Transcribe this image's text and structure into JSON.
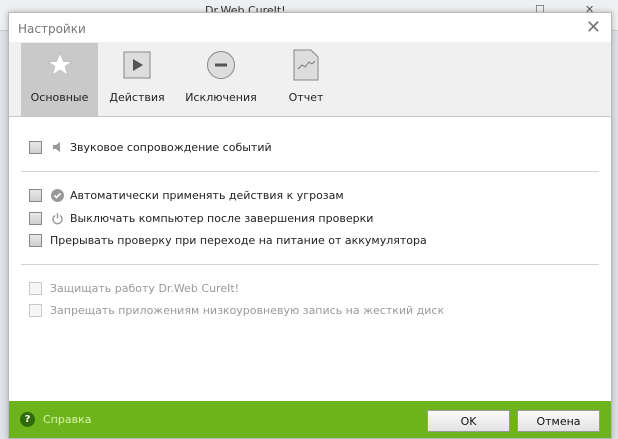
{
  "background_window": {
    "title": "Dr.Web CureIt!"
  },
  "dialog": {
    "title": "Настройки"
  },
  "tabs": [
    {
      "label": "Основные",
      "icon": "star-icon",
      "selected": true
    },
    {
      "label": "Действия",
      "icon": "play-icon",
      "selected": false
    },
    {
      "label": "Исключения",
      "icon": "minus-circle-icon",
      "selected": false
    },
    {
      "label": "Отчет",
      "icon": "report-document-icon",
      "selected": false
    }
  ],
  "options": [
    {
      "label": "Звуковое сопровождение событий",
      "icon": "speaker-icon",
      "checked": false,
      "enabled": true
    },
    {
      "label": "Автоматически применять действия к угрозам",
      "icon": "check-circle-icon",
      "checked": false,
      "enabled": true
    },
    {
      "label": "Выключать компьютер после завершения проверки",
      "icon": "power-icon",
      "checked": false,
      "enabled": true
    },
    {
      "label": "Прерывать проверку при переходе на питание от аккумулятора",
      "checked": false,
      "enabled": true
    },
    {
      "label": "Защищать работу Dr.Web CureIt!",
      "checked": false,
      "enabled": false
    },
    {
      "label": "Запрещать приложениям низкоуровневую запись на жесткий диск",
      "checked": false,
      "enabled": false
    }
  ],
  "footer": {
    "help": "Справка",
    "ok": "OK",
    "cancel": "Отмена",
    "color": "#6db31b"
  }
}
